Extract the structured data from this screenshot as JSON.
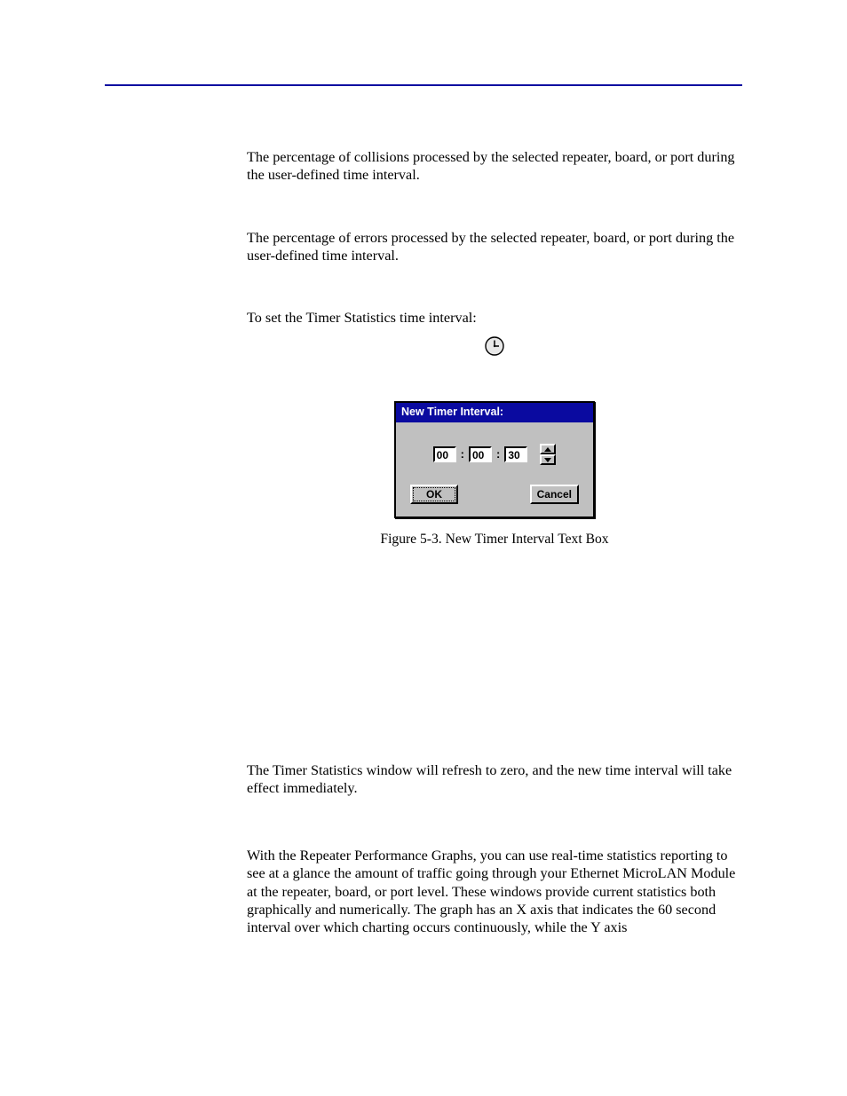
{
  "paragraphs": {
    "p1": "The percentage of collisions processed by the selected repeater, board, or port during the user-defined time interval.",
    "p2": "The percentage of errors processed by the selected repeater, board, or port during the user-defined time interval.",
    "instr": "To set the Timer Statistics time interval:",
    "p3": "The Timer Statistics window will refresh to zero, and the new time interval will take effect immediately.",
    "p4": "With the Repeater Performance Graphs, you can use real-time statistics reporting to see at a glance the amount of traffic going through your Ethernet MicroLAN Module at the repeater, board, or port level. These windows provide current statistics both graphically and numerically. The graph has an X axis that indicates the 60 second interval over which charting occurs continuously, while the Y axis"
  },
  "dialog": {
    "title": "New Timer Interval:",
    "hours": "00",
    "minutes": "00",
    "seconds": "30",
    "ok_label": "OK",
    "cancel_label": "Cancel"
  },
  "figure_caption": "Figure 5-3.  New Timer Interval Text Box"
}
